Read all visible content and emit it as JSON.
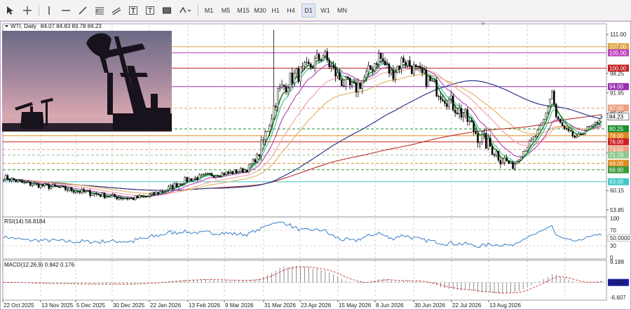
{
  "toolbar": {
    "timeframes": [
      "M1",
      "M5",
      "M15",
      "M30",
      "H1",
      "H4",
      "D1",
      "W1",
      "MN"
    ],
    "active_timeframe": "D1"
  },
  "symbol": {
    "header": "WTI, Daily",
    "ohlc": "84.07 84.83 83.78 84.23"
  },
  "rsi": {
    "label": "RSI(14) 56.8184",
    "value": 56.8,
    "levels": [
      "100",
      "70",
      "50.0000",
      "30",
      "0"
    ]
  },
  "macd": {
    "label": "MACD(12,26,9) 0.842 0.176",
    "axis": [
      "9.188",
      "0.000",
      "-6.607"
    ]
  },
  "price_axis": {
    "ticks": [
      "111.00",
      "98.25",
      "91.95",
      "85.15",
      "72.35",
      "60.15",
      "53.85"
    ],
    "tick_values": [
      111.0,
      98.25,
      91.95,
      85.15,
      72.35,
      60.15,
      53.85
    ],
    "current": "84.23"
  },
  "levels": [
    {
      "label": "107.00",
      "value": 107.0,
      "color": "#d9a441",
      "style": "solid"
    },
    {
      "label": "105.00",
      "value": 105.0,
      "color": "#c040c0",
      "style": "solid"
    },
    {
      "label": "100.00",
      "value": 100.0,
      "color": "#c02020",
      "style": "solid"
    },
    {
      "label": "94.00",
      "value": 94.0,
      "color": "#9a30b0",
      "style": "solid"
    },
    {
      "label": "87.00",
      "value": 87.0,
      "color": "#e8a080",
      "style": "dashed"
    },
    {
      "label": "80.25",
      "value": 80.25,
      "color": "#1f8f2f",
      "style": "dashed"
    },
    {
      "label": "78.00",
      "value": 78.0,
      "color": "#e08a20",
      "style": "solid"
    },
    {
      "label": "76.00",
      "value": 76.0,
      "color": "#cc2020",
      "style": "solid"
    },
    {
      "label": "73.50",
      "value": 73.5,
      "color": "#e8a080",
      "style": "dashed"
    },
    {
      "label": "71.70",
      "value": 71.7,
      "color": "#90c890",
      "style": "dashed"
    },
    {
      "label": "69.00",
      "value": 69.0,
      "color": "#e08a20",
      "style": "dashed"
    },
    {
      "label": "66.90",
      "value": 66.9,
      "color": "#3a9a3a",
      "style": "dashed"
    },
    {
      "label": "63.00",
      "value": 63.0,
      "color": "#40c8c8",
      "style": "solid"
    }
  ],
  "dates": [
    "22 Oct 2025",
    "13 Nov 2025",
    "5 Dec 2025",
    "30 Dec 2025",
    "22 Jan 2026",
    "13 Feb 2026",
    "9 Mar 2026",
    "31 Mar 2026",
    "23 Apr 2026",
    "15 May 2026",
    "8 Jun 2026",
    "30 Jun 2026",
    "22 Jul 2026",
    "13 Aug 2026"
  ],
  "colors": {
    "candle": "#000000",
    "ema_fast": "#1a8a1a",
    "ema_cyan": "#40b0a0",
    "ema_purple": "#b040b0",
    "ema_pink": "#f0a0a0",
    "ema_orange": "#e0b060",
    "sma_navy": "#1a2a80",
    "sma_red": "#c03030",
    "rsi_line": "#2070c0",
    "macd_hist": "#808080",
    "macd_signal": "#c03030",
    "grid": "#b0b0b0"
  },
  "icons": [
    "cursor-icon",
    "crosshair-icon",
    "vertical-line-icon",
    "horizontal-line-icon",
    "trendline-icon",
    "fibonacci-icon",
    "text-icon",
    "label-icon",
    "rectangle-icon",
    "shapes-icon"
  ]
}
